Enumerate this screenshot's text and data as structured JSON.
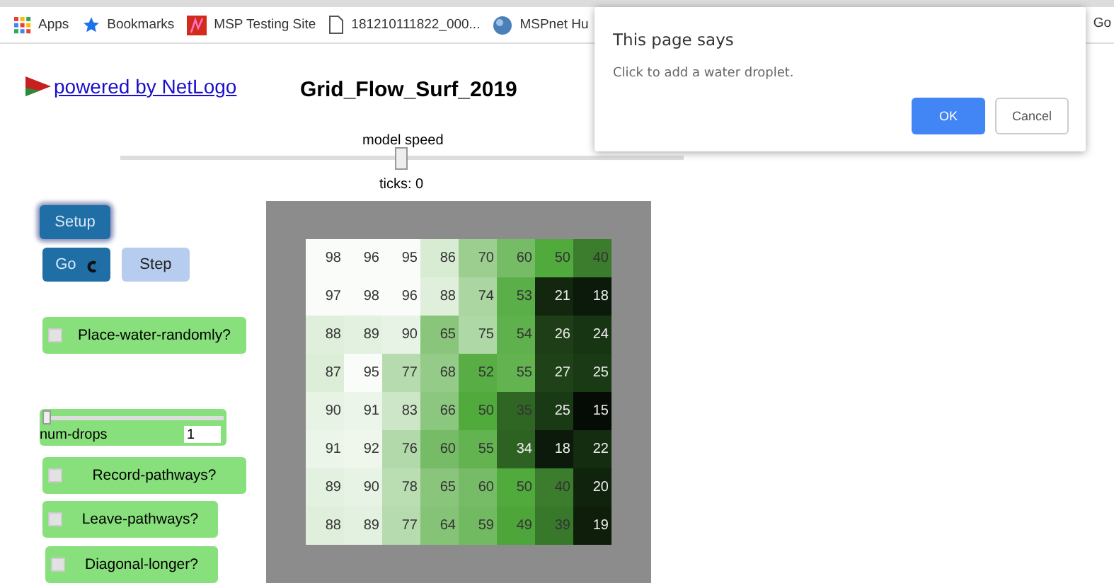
{
  "bookmarks": [
    {
      "label": "Apps",
      "kind": "apps"
    },
    {
      "label": "Bookmarks",
      "kind": "star"
    },
    {
      "label": "MSP Testing Site",
      "kind": "red"
    },
    {
      "label": "181210111822_000...",
      "kind": "page"
    },
    {
      "label": "MSPnet Hu",
      "kind": "globe"
    }
  ],
  "bookmark_right": "Go",
  "header": {
    "link": "powered by NetLogo",
    "title": "Grid_Flow_Surf_2019"
  },
  "speed_slider": {
    "label": "model speed",
    "level": 0.5
  },
  "ticks": "ticks: 0",
  "buttons": [
    {
      "label": "Setup",
      "kind": "setup"
    },
    {
      "label": "Go",
      "kind": "forever"
    },
    {
      "label": "Step",
      "kind": "step"
    }
  ],
  "switches": [
    {
      "label": "Place-water-randomly?",
      "on": false
    },
    {
      "label": "Record-pathways?",
      "on": false
    },
    {
      "label": "Leave-pathways?",
      "on": false
    },
    {
      "label": "Diagonal-longer?",
      "on": false
    }
  ],
  "num_drops": {
    "label": "num-drops",
    "value": "1",
    "level": 0
  },
  "grid": [
    [
      "98",
      "96",
      "95",
      "86",
      "70",
      "60",
      "50",
      "40"
    ],
    [
      "97",
      "98",
      "96",
      "88",
      "74",
      "53",
      "21",
      "18"
    ],
    [
      "88",
      "89",
      "90",
      "65",
      "75",
      "54",
      "26",
      "24"
    ],
    [
      "87",
      "95",
      "77",
      "68",
      "52",
      "55",
      "27",
      "25"
    ],
    [
      "90",
      "91",
      "83",
      "66",
      "50",
      "35",
      "25",
      "15"
    ],
    [
      "91",
      "92",
      "76",
      "60",
      "55",
      "34",
      "18",
      "22"
    ],
    [
      "89",
      "90",
      "78",
      "65",
      "60",
      "50",
      "40",
      "20"
    ],
    [
      "88",
      "89",
      "77",
      "64",
      "59",
      "49",
      "39",
      "19"
    ]
  ],
  "dialog": {
    "title": "This page says",
    "message": "Click to add a water droplet.",
    "ok": "OK",
    "cancel": "Cancel"
  }
}
